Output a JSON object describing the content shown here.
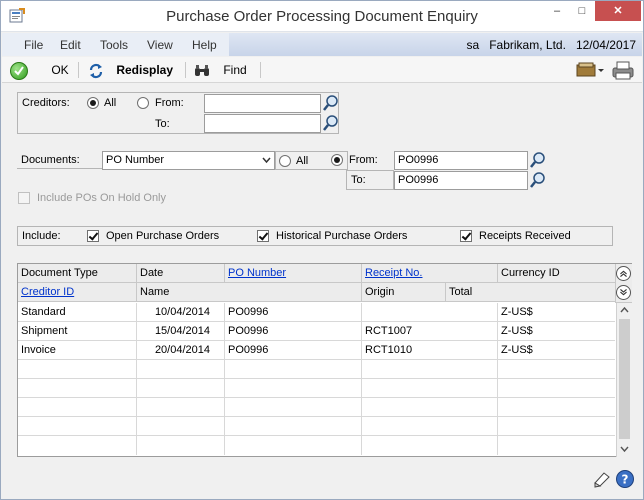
{
  "window": {
    "title": "Purchase Order Processing Document Enquiry",
    "minimize": "–",
    "maximize": "□",
    "close": "✕"
  },
  "menu": {
    "items": [
      "File",
      "Edit",
      "Tools",
      "View",
      "Help"
    ],
    "user": "sa",
    "company": "Fabrikam, Ltd.",
    "date": "12/04/2017"
  },
  "toolbar": {
    "ok_label": "OK",
    "redisplay_label": "Redisplay",
    "find_label": "Find"
  },
  "creditors": {
    "label": "Creditors:",
    "all_label": "All",
    "from_label": "From:",
    "to_label": "To:",
    "selected": "All",
    "from_value": "",
    "to_value": ""
  },
  "documents": {
    "label": "Documents:",
    "type_selected": "PO Number",
    "all_label": "All",
    "from_label": "From:",
    "to_label": "To:",
    "selected": "From",
    "from_value": "PO0996",
    "to_value": "PO0996"
  },
  "on_hold": {
    "label": "Include POs On Hold Only",
    "checked": false,
    "enabled": false
  },
  "include": {
    "label": "Include:",
    "options": [
      {
        "label": "Open Purchase Orders",
        "checked": true
      },
      {
        "label": "Historical Purchase Orders",
        "checked": true
      },
      {
        "label": "Receipts Received",
        "checked": true
      }
    ]
  },
  "grid": {
    "headers_row1": [
      "Document Type",
      "Date",
      "PO Number",
      "Receipt No.",
      "Currency ID"
    ],
    "headers_row2": [
      "Creditor ID",
      "Name",
      "Origin",
      "Total"
    ],
    "rows": [
      {
        "doc_type": "Standard",
        "date": "10/04/2014",
        "po": "PO0996",
        "receipt": "",
        "currency": "Z-US$"
      },
      {
        "doc_type": "Shipment",
        "date": "15/04/2014",
        "po": "PO0996",
        "receipt": "RCT1007",
        "currency": "Z-US$"
      },
      {
        "doc_type": "Invoice",
        "date": "20/04/2014",
        "po": "PO0996",
        "receipt": "RCT1010",
        "currency": "Z-US$"
      },
      {
        "doc_type": "",
        "date": "",
        "po": "",
        "receipt": "",
        "currency": ""
      },
      {
        "doc_type": "",
        "date": "",
        "po": "",
        "receipt": "",
        "currency": ""
      },
      {
        "doc_type": "",
        "date": "",
        "po": "",
        "receipt": "",
        "currency": ""
      },
      {
        "doc_type": "",
        "date": "",
        "po": "",
        "receipt": "",
        "currency": ""
      },
      {
        "doc_type": "",
        "date": "",
        "po": "",
        "receipt": "",
        "currency": ""
      }
    ]
  },
  "icons": [
    "app-icon",
    "ok-icon",
    "redisplay-icon",
    "find-binoculars-icon",
    "lookup-magnifier-icon",
    "dropdown-arrow-icon",
    "collapse-icon",
    "expand-icon",
    "note-icon",
    "help-icon",
    "print-icon",
    "toolbar-menu-icon"
  ],
  "colors": {
    "link": "#0033cc",
    "close_button": "#c75050",
    "ok_green": "#2e9a1b"
  }
}
